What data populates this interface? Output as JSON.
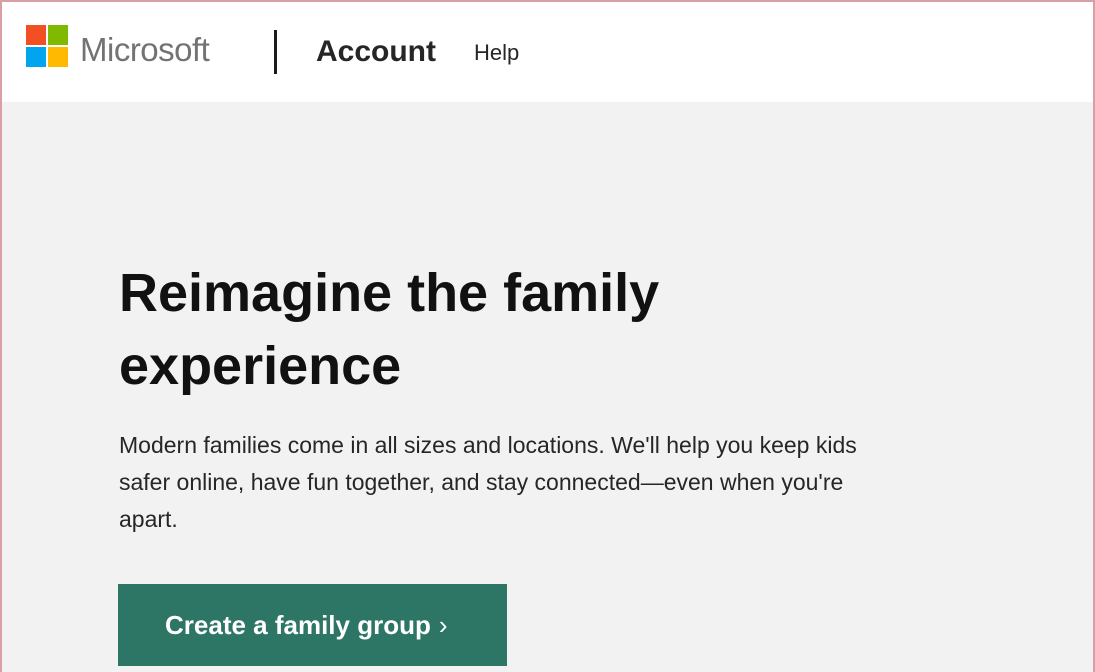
{
  "header": {
    "brand": "Microsoft",
    "nav_account": "Account",
    "nav_help": "Help",
    "logo_colors": [
      "#f25022",
      "#7fba00",
      "#00a4ef",
      "#ffb900"
    ]
  },
  "hero": {
    "title_line1": "Reimagine the family",
    "title_line2": "experience",
    "description_line1": "Modern families come in all sizes and locations. We'll help you keep kids",
    "description_line2": "safer online, have fun together, and stay connected—even when you're",
    "description_line3": "apart.",
    "cta_label": "Create a family group",
    "cta_icon": "chevron-right-icon",
    "cta_color": "#2d7565"
  }
}
